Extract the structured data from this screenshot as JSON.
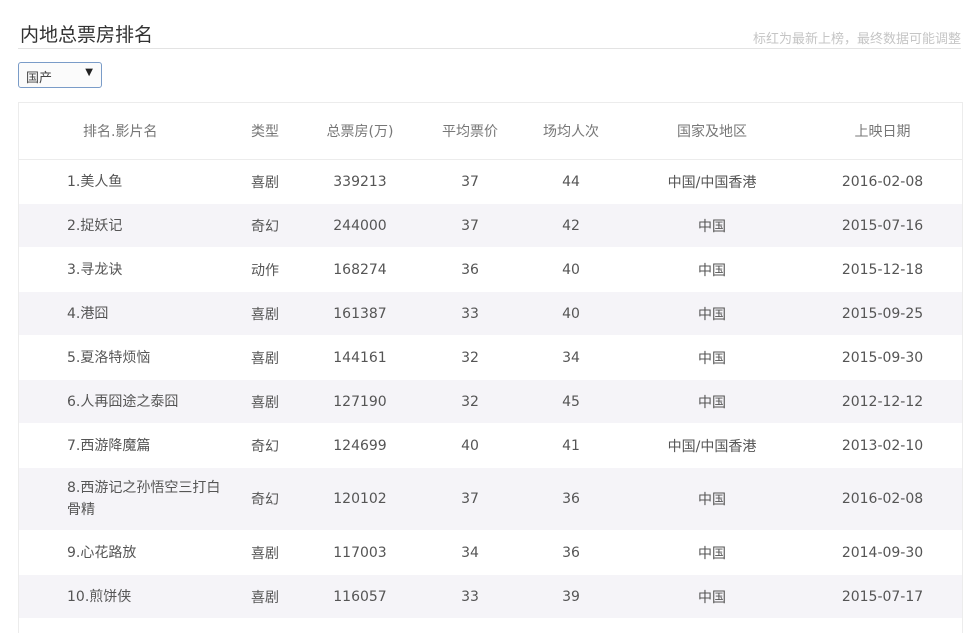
{
  "header": {
    "title": "内地总票房排名",
    "note": "标红为最新上榜，最终数据可能调整"
  },
  "filter": {
    "selected": "国产",
    "arrow_icon": "triangle-down-icon"
  },
  "table": {
    "columns": [
      "排名.影片名",
      "类型",
      "总票房(万)",
      "平均票价",
      "场均人次",
      "国家及地区",
      "上映日期"
    ],
    "rows": [
      {
        "name": "1.美人鱼",
        "genre": "喜剧",
        "box": "339213",
        "price": "37",
        "attendance": "44",
        "region": "中国/中国香港",
        "date": "2016-02-08"
      },
      {
        "name": "2.捉妖记",
        "genre": "奇幻",
        "box": "244000",
        "price": "37",
        "attendance": "42",
        "region": "中国",
        "date": "2015-07-16"
      },
      {
        "name": "3.寻龙诀",
        "genre": "动作",
        "box": "168274",
        "price": "36",
        "attendance": "40",
        "region": "中国",
        "date": "2015-12-18"
      },
      {
        "name": "4.港囧",
        "genre": "喜剧",
        "box": "161387",
        "price": "33",
        "attendance": "40",
        "region": "中国",
        "date": "2015-09-25"
      },
      {
        "name": "5.夏洛特烦恼",
        "genre": "喜剧",
        "box": "144161",
        "price": "32",
        "attendance": "34",
        "region": "中国",
        "date": "2015-09-30"
      },
      {
        "name": "6.人再囧途之泰囧",
        "genre": "喜剧",
        "box": "127190",
        "price": "32",
        "attendance": "45",
        "region": "中国",
        "date": "2012-12-12"
      },
      {
        "name": "7.西游降魔篇",
        "genre": "奇幻",
        "box": "124699",
        "price": "40",
        "attendance": "41",
        "region": "中国/中国香港",
        "date": "2013-02-10"
      },
      {
        "name": "8.西游记之孙悟空三打白骨精",
        "genre": "奇幻",
        "box": "120102",
        "price": "37",
        "attendance": "36",
        "region": "中国",
        "date": "2016-02-08"
      },
      {
        "name": "9.心花路放",
        "genre": "喜剧",
        "box": "117003",
        "price": "34",
        "attendance": "36",
        "region": "中国",
        "date": "2014-09-30"
      },
      {
        "name": "10.煎饼侠",
        "genre": "喜剧",
        "box": "116057",
        "price": "33",
        "attendance": "39",
        "region": "中国",
        "date": "2015-07-17"
      }
    ]
  }
}
